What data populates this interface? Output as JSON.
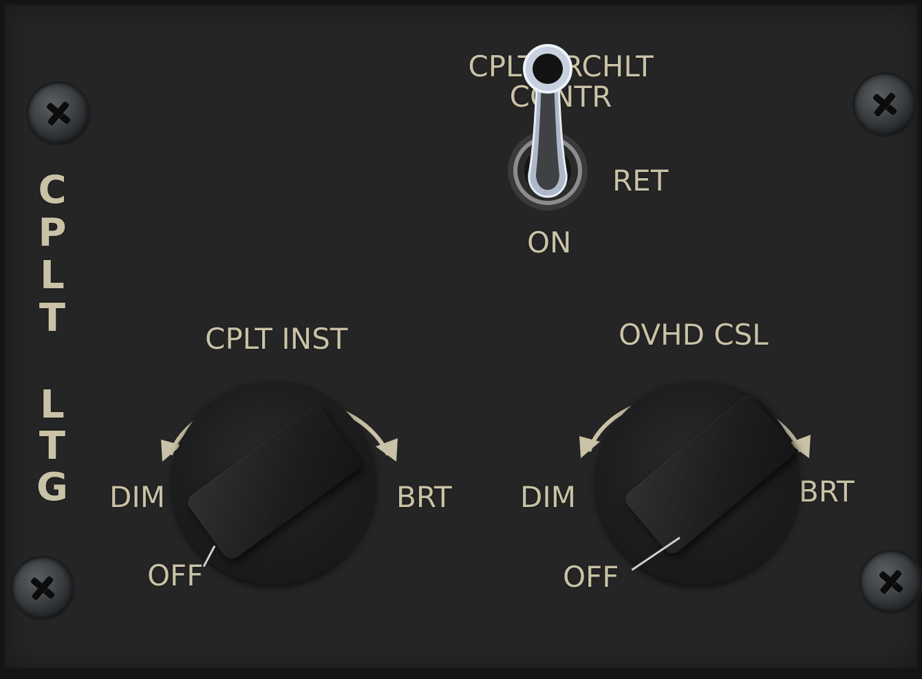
{
  "panel": {
    "side_label_letters": [
      "C",
      "P",
      "L",
      "T",
      "L",
      "T",
      "G"
    ],
    "searchlight_switch": {
      "label_line1": "CPLT SRCHLT",
      "label_line2": "CONTR",
      "position_right": "RET",
      "position_bottom": "ON"
    },
    "cplt_inst_knob": {
      "title": "CPLT INST",
      "left_label": "DIM",
      "right_label": "BRT",
      "off_label": "OFF"
    },
    "ovhd_csl_knob": {
      "title": "OVHD CSL",
      "left_label": "DIM",
      "right_label": "BRT",
      "off_label": "OFF"
    }
  },
  "colors": {
    "panel": "#252525",
    "legend": "#c9c2a6",
    "knob": "#1c1c1c",
    "toggle_metal": "#b9c4d6"
  },
  "icons": [
    "screw-icon",
    "toggle-switch",
    "rotary-knob",
    "arc-arrow-icon"
  ]
}
